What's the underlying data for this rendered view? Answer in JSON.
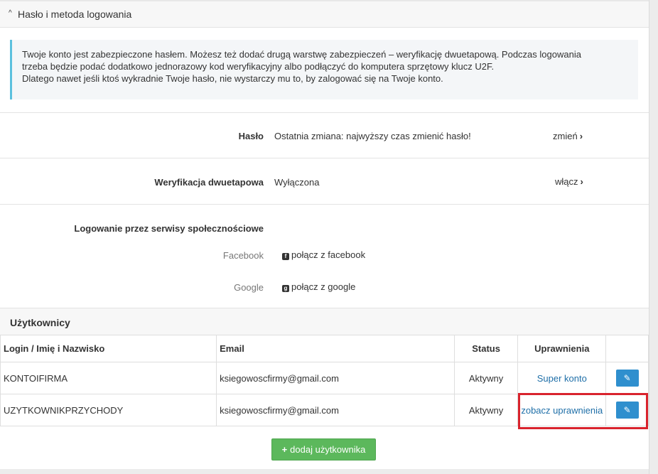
{
  "password_section": {
    "title": "Hasło i metoda logowania",
    "caret_glyph": "^",
    "info_lines": [
      "Twoje konto jest zabezpieczone hasłem. Możesz też dodać drugą warstwę zabezpieczeń – weryfikację dwuetapową. Podczas logowania",
      "trzeba będzie podać dodatkowo jednorazowy kod weryfikacyjny albo podłączyć do komputera sprzętowy klucz U2F.",
      "Dlatego nawet jeśli ktoś wykradnie Twoje hasło, nie wystarczy mu to, by zalogować się na Twoje konto."
    ],
    "password": {
      "label": "Hasło",
      "value": "Ostatnia zmiana: najwyższy czas zmienić hasło!",
      "action": "zmień"
    },
    "two_factor": {
      "label": "Weryfikacja dwuetapowa",
      "value": "Wyłączona",
      "action": "włącz"
    },
    "social": {
      "label": "Logowanie przez serwisy społecznościowe",
      "facebook_label": "Facebook",
      "facebook_action": "połącz z facebook",
      "google_label": "Google",
      "google_action": "połącz z google"
    }
  },
  "users_section": {
    "title": "Użytkownicy",
    "columns": {
      "login": "Login / Imię i Nazwisko",
      "email": "Email",
      "status": "Status",
      "permissions": "Uprawnienia"
    },
    "rows": [
      {
        "login": "KONTOIFIRMA",
        "email": "ksiegowoscfirmy@gmail.com",
        "status": "Aktywny",
        "permissions": "Super konto"
      },
      {
        "login": "UZYTKOWNIKPRZYCHODY",
        "email": "ksiegowoscfirmy@gmail.com",
        "status": "Aktywny",
        "permissions": "zobacz uprawnienia"
      }
    ],
    "add_button": "dodaj użytkownika"
  },
  "colors": {
    "info_accent": "#5bc0de",
    "link_blue": "#1f6fa8",
    "edit_button": "#2f8fce",
    "add_button": "#5cb85c",
    "highlight_red": "#d9232d"
  },
  "icons": {
    "chevron": "chevron-right-icon",
    "facebook": "facebook-icon",
    "google": "google-plus-icon",
    "edit": "edit-icon",
    "plus": "plus-icon"
  }
}
